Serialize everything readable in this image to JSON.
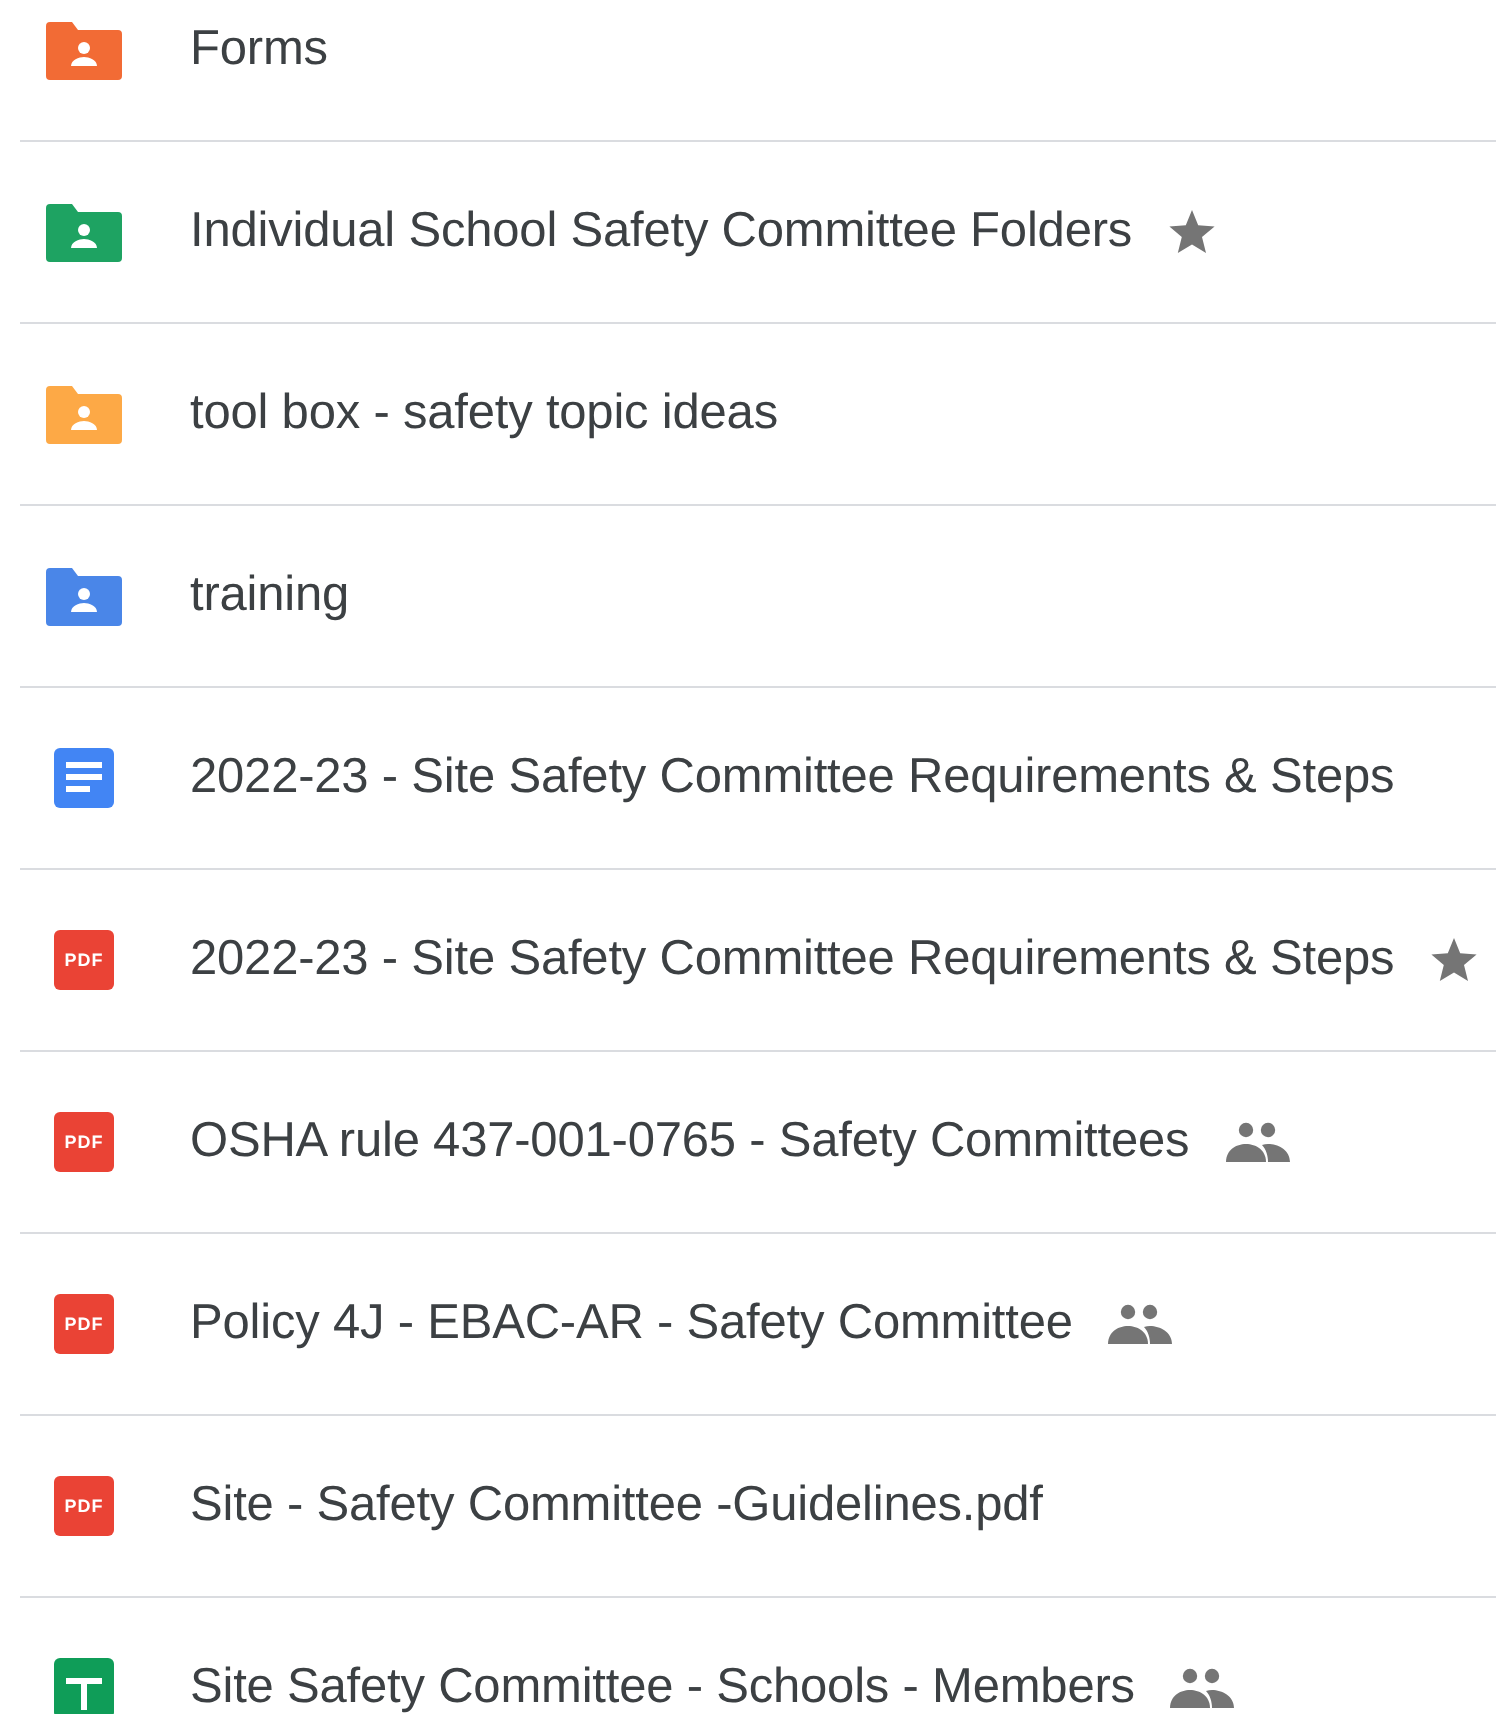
{
  "files": [
    {
      "kind": "folder",
      "color": "#f26b35",
      "name": "Forms",
      "starred": false,
      "shared": false
    },
    {
      "kind": "folder",
      "color": "#1ea362",
      "name": "Individual School Safety Committee Folders",
      "starred": true,
      "shared": false
    },
    {
      "kind": "folder",
      "color": "#fda946",
      "name": "tool box - safety topic ideas",
      "starred": false,
      "shared": false
    },
    {
      "kind": "folder",
      "color": "#4a86e8",
      "name": "training",
      "starred": false,
      "shared": false
    },
    {
      "kind": "doc",
      "name": "2022-23 - Site Safety Committee Requirements & Steps",
      "starred": false,
      "shared": false
    },
    {
      "kind": "pdf",
      "badge": "PDF",
      "name": "2022-23 - Site Safety Committee Requirements & Steps",
      "starred": true,
      "shared": false
    },
    {
      "kind": "pdf",
      "badge": "PDF",
      "name": "OSHA rule 437-001-0765 - Safety Committees",
      "starred": false,
      "shared": true
    },
    {
      "kind": "pdf",
      "badge": "PDF",
      "name": "Policy 4J - EBAC-AR - Safety Committee",
      "starred": false,
      "shared": true
    },
    {
      "kind": "pdf",
      "badge": "PDF",
      "name": "Site - Safety Committee -Guidelines.pdf",
      "starred": false,
      "shared": false
    },
    {
      "kind": "sheet",
      "name": "Site Safety Committee - Schools - Members",
      "starred": false,
      "shared": true
    }
  ]
}
